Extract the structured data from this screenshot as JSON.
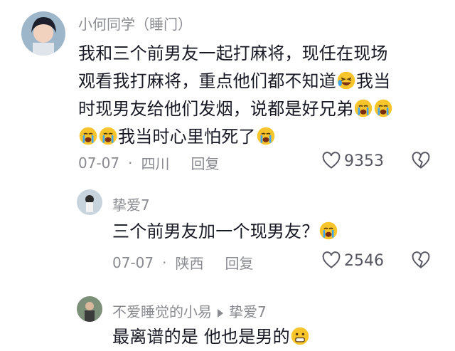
{
  "comments": [
    {
      "name": "小何同学（睡门）",
      "lines": [
        "我和三个前男友一起打麻将，现任在现场",
        "观看我打麻将，重点他们都不知道",
        "我当",
        "时现男友给他们发烟，说都是好兄弟",
        "我当时心里怕死了"
      ],
      "date": "07-07",
      "sep": "·",
      "location": "四川",
      "reply": "回复",
      "likes": "9353"
    },
    {
      "name": "挚爱7",
      "text": "三个前男友加一个现男友？",
      "date": "07-07",
      "sep": "·",
      "location": "陕西",
      "reply": "回复",
      "likes": "2546"
    },
    {
      "name": "不爱睡觉的小易",
      "reply_to": "挚爱7",
      "text": "最离谱的是 他也是男的"
    }
  ],
  "colors": {
    "name": "#8a8b91",
    "text": "#161823",
    "emoji": "#f7c52b"
  }
}
